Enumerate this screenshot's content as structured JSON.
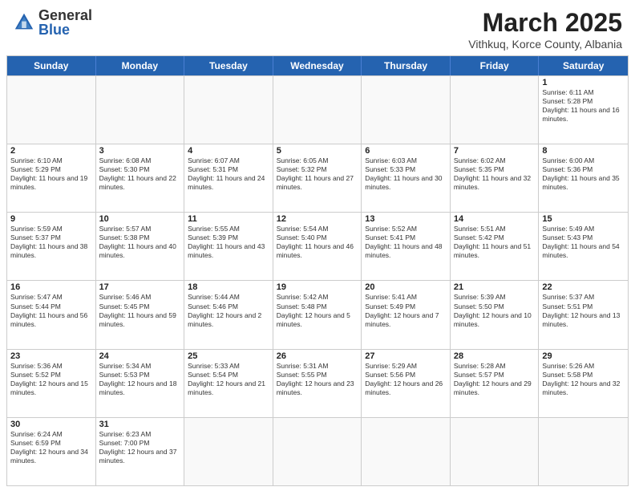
{
  "header": {
    "logo_general": "General",
    "logo_blue": "Blue",
    "title": "March 2025",
    "subtitle": "Vithkuq, Korce County, Albania"
  },
  "weekdays": [
    "Sunday",
    "Monday",
    "Tuesday",
    "Wednesday",
    "Thursday",
    "Friday",
    "Saturday"
  ],
  "weeks": [
    [
      {
        "day": "",
        "info": ""
      },
      {
        "day": "",
        "info": ""
      },
      {
        "day": "",
        "info": ""
      },
      {
        "day": "",
        "info": ""
      },
      {
        "day": "",
        "info": ""
      },
      {
        "day": "",
        "info": ""
      },
      {
        "day": "1",
        "info": "Sunrise: 6:11 AM\nSunset: 5:28 PM\nDaylight: 11 hours and 16 minutes."
      }
    ],
    [
      {
        "day": "2",
        "info": "Sunrise: 6:10 AM\nSunset: 5:29 PM\nDaylight: 11 hours and 19 minutes."
      },
      {
        "day": "3",
        "info": "Sunrise: 6:08 AM\nSunset: 5:30 PM\nDaylight: 11 hours and 22 minutes."
      },
      {
        "day": "4",
        "info": "Sunrise: 6:07 AM\nSunset: 5:31 PM\nDaylight: 11 hours and 24 minutes."
      },
      {
        "day": "5",
        "info": "Sunrise: 6:05 AM\nSunset: 5:32 PM\nDaylight: 11 hours and 27 minutes."
      },
      {
        "day": "6",
        "info": "Sunrise: 6:03 AM\nSunset: 5:33 PM\nDaylight: 11 hours and 30 minutes."
      },
      {
        "day": "7",
        "info": "Sunrise: 6:02 AM\nSunset: 5:35 PM\nDaylight: 11 hours and 32 minutes."
      },
      {
        "day": "8",
        "info": "Sunrise: 6:00 AM\nSunset: 5:36 PM\nDaylight: 11 hours and 35 minutes."
      }
    ],
    [
      {
        "day": "9",
        "info": "Sunrise: 5:59 AM\nSunset: 5:37 PM\nDaylight: 11 hours and 38 minutes."
      },
      {
        "day": "10",
        "info": "Sunrise: 5:57 AM\nSunset: 5:38 PM\nDaylight: 11 hours and 40 minutes."
      },
      {
        "day": "11",
        "info": "Sunrise: 5:55 AM\nSunset: 5:39 PM\nDaylight: 11 hours and 43 minutes."
      },
      {
        "day": "12",
        "info": "Sunrise: 5:54 AM\nSunset: 5:40 PM\nDaylight: 11 hours and 46 minutes."
      },
      {
        "day": "13",
        "info": "Sunrise: 5:52 AM\nSunset: 5:41 PM\nDaylight: 11 hours and 48 minutes."
      },
      {
        "day": "14",
        "info": "Sunrise: 5:51 AM\nSunset: 5:42 PM\nDaylight: 11 hours and 51 minutes."
      },
      {
        "day": "15",
        "info": "Sunrise: 5:49 AM\nSunset: 5:43 PM\nDaylight: 11 hours and 54 minutes."
      }
    ],
    [
      {
        "day": "16",
        "info": "Sunrise: 5:47 AM\nSunset: 5:44 PM\nDaylight: 11 hours and 56 minutes."
      },
      {
        "day": "17",
        "info": "Sunrise: 5:46 AM\nSunset: 5:45 PM\nDaylight: 11 hours and 59 minutes."
      },
      {
        "day": "18",
        "info": "Sunrise: 5:44 AM\nSunset: 5:46 PM\nDaylight: 12 hours and 2 minutes."
      },
      {
        "day": "19",
        "info": "Sunrise: 5:42 AM\nSunset: 5:48 PM\nDaylight: 12 hours and 5 minutes."
      },
      {
        "day": "20",
        "info": "Sunrise: 5:41 AM\nSunset: 5:49 PM\nDaylight: 12 hours and 7 minutes."
      },
      {
        "day": "21",
        "info": "Sunrise: 5:39 AM\nSunset: 5:50 PM\nDaylight: 12 hours and 10 minutes."
      },
      {
        "day": "22",
        "info": "Sunrise: 5:37 AM\nSunset: 5:51 PM\nDaylight: 12 hours and 13 minutes."
      }
    ],
    [
      {
        "day": "23",
        "info": "Sunrise: 5:36 AM\nSunset: 5:52 PM\nDaylight: 12 hours and 15 minutes."
      },
      {
        "day": "24",
        "info": "Sunrise: 5:34 AM\nSunset: 5:53 PM\nDaylight: 12 hours and 18 minutes."
      },
      {
        "day": "25",
        "info": "Sunrise: 5:33 AM\nSunset: 5:54 PM\nDaylight: 12 hours and 21 minutes."
      },
      {
        "day": "26",
        "info": "Sunrise: 5:31 AM\nSunset: 5:55 PM\nDaylight: 12 hours and 23 minutes."
      },
      {
        "day": "27",
        "info": "Sunrise: 5:29 AM\nSunset: 5:56 PM\nDaylight: 12 hours and 26 minutes."
      },
      {
        "day": "28",
        "info": "Sunrise: 5:28 AM\nSunset: 5:57 PM\nDaylight: 12 hours and 29 minutes."
      },
      {
        "day": "29",
        "info": "Sunrise: 5:26 AM\nSunset: 5:58 PM\nDaylight: 12 hours and 32 minutes."
      }
    ],
    [
      {
        "day": "30",
        "info": "Sunrise: 6:24 AM\nSunset: 6:59 PM\nDaylight: 12 hours and 34 minutes."
      },
      {
        "day": "31",
        "info": "Sunrise: 6:23 AM\nSunset: 7:00 PM\nDaylight: 12 hours and 37 minutes."
      },
      {
        "day": "",
        "info": ""
      },
      {
        "day": "",
        "info": ""
      },
      {
        "day": "",
        "info": ""
      },
      {
        "day": "",
        "info": ""
      },
      {
        "day": "",
        "info": ""
      }
    ]
  ]
}
